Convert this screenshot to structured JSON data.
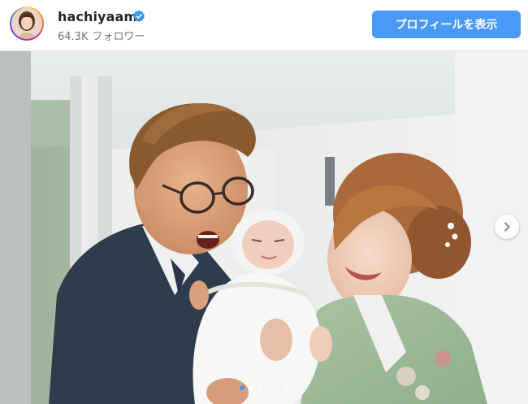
{
  "header": {
    "username": "hachiyaami",
    "follower_count": "64.3K",
    "follower_label": "フォロワー",
    "profile_button_label": "プロフィールを表示"
  },
  "carousel": {
    "slide_count": 6,
    "active_index": 0
  },
  "colors": {
    "accent_blue": "#4a98f7",
    "verified_blue": "#3897f0",
    "text_primary": "#262626",
    "text_secondary": "#737373"
  },
  "icons": {
    "verified": "verified-badge-icon",
    "next": "chevron-right-icon"
  }
}
